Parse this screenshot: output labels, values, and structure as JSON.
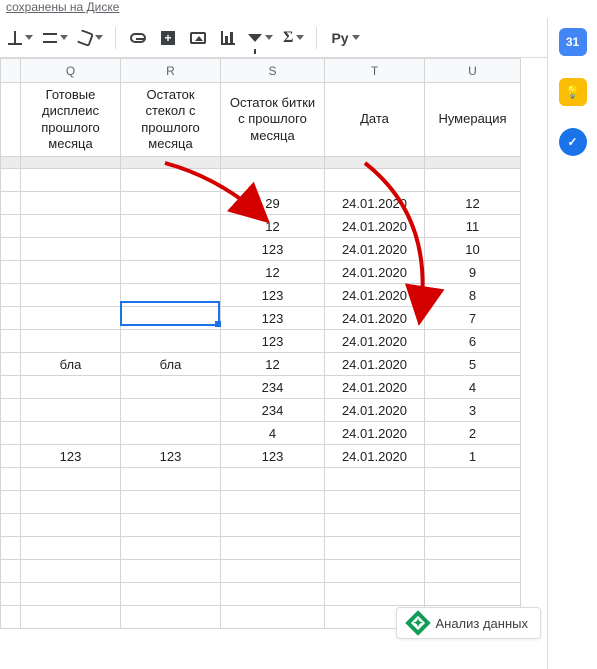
{
  "status_text": "сохранены на Диске",
  "side": {
    "calendar": "31",
    "task": "✓"
  },
  "explore_label": "Анализ данных",
  "toolbar": {
    "py_label": "Py"
  },
  "columns": [
    {
      "letter": "Q",
      "header": "Готовые дисплеис прошлого месяца"
    },
    {
      "letter": "R",
      "header": "Остаток стекол с прошлого месяца"
    },
    {
      "letter": "S",
      "header": "Остаток битки с прошлого месяца"
    },
    {
      "letter": "T",
      "header": "Дата"
    },
    {
      "letter": "U",
      "header": "Нумерация"
    }
  ],
  "rows": [
    {
      "Q": "",
      "R": "",
      "S": "",
      "T": "",
      "U": ""
    },
    {
      "Q": "",
      "R": "",
      "S": "29",
      "T": "24.01.2020",
      "U": "12"
    },
    {
      "Q": "",
      "R": "",
      "S": "12",
      "T": "24.01.2020",
      "U": "11"
    },
    {
      "Q": "",
      "R": "",
      "S": "123",
      "T": "24.01.2020",
      "U": "10"
    },
    {
      "Q": "",
      "R": "",
      "S": "12",
      "T": "24.01.2020",
      "U": "9"
    },
    {
      "Q": "",
      "R": "",
      "S": "123",
      "T": "24.01.2020",
      "U": "8"
    },
    {
      "Q": "",
      "R": "",
      "S": "123",
      "T": "24.01.2020",
      "U": "7"
    },
    {
      "Q": "",
      "R": "",
      "S": "123",
      "T": "24.01.2020",
      "U": "6"
    },
    {
      "Q": "бла",
      "R": "бла",
      "S": "12",
      "T": "24.01.2020",
      "U": "5"
    },
    {
      "Q": "",
      "R": "",
      "S": "234",
      "T": "24.01.2020",
      "U": "4"
    },
    {
      "Q": "",
      "R": "",
      "S": "234",
      "T": "24.01.2020",
      "U": "3"
    },
    {
      "Q": "",
      "R": "",
      "S": "4",
      "T": "24.01.2020",
      "U": "2"
    },
    {
      "Q": "123",
      "R": "123",
      "S": "123",
      "T": "24.01.2020",
      "U": "1"
    },
    {
      "Q": "",
      "R": "",
      "S": "",
      "T": "",
      "U": ""
    },
    {
      "Q": "",
      "R": "",
      "S": "",
      "T": "",
      "U": ""
    },
    {
      "Q": "",
      "R": "",
      "S": "",
      "T": "",
      "U": ""
    },
    {
      "Q": "",
      "R": "",
      "S": "",
      "T": "",
      "U": ""
    },
    {
      "Q": "",
      "R": "",
      "S": "",
      "T": "",
      "U": ""
    },
    {
      "Q": "",
      "R": "",
      "S": "",
      "T": "",
      "U": ""
    },
    {
      "Q": "",
      "R": "",
      "S": "",
      "T": "",
      "U": ""
    }
  ],
  "active_cell": {
    "col": "R",
    "row_index": 5
  }
}
